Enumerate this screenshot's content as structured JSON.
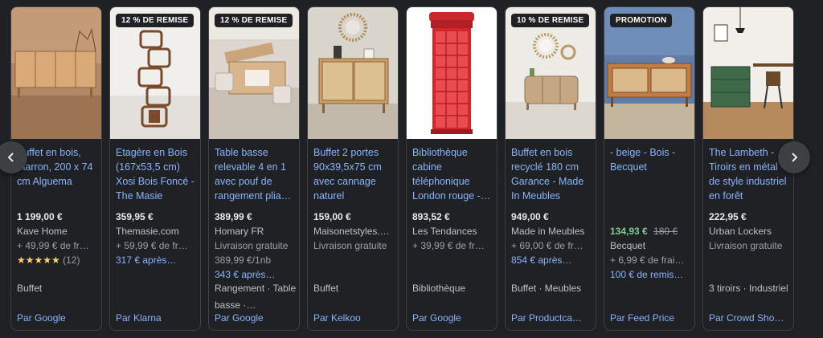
{
  "carousel": {
    "prev_icon": "chevron-left-icon",
    "next_icon": "chevron-right-icon",
    "products": [
      {
        "badge": "",
        "title": "Buffet en bois, marron, 200 x 74 cm Alguema",
        "price": "1 199,00 €",
        "merchant": "Kave Home",
        "shipping": "+ 49,99 € de fr…",
        "rating_stars": "★★★★★",
        "rating_count": "(12)",
        "category": "Buffet",
        "by": "Par Google"
      },
      {
        "badge": "12 % DE REMISE",
        "title": "Etagère en Bois (167x53,5 cm) Xosi Bois Foncé - The Masie",
        "price": "359,95 €",
        "merchant": "Themasie.com",
        "shipping": "+ 59,99 € de fr…",
        "payment": "317 € après…",
        "category": "",
        "by": "Par Klarna"
      },
      {
        "badge": "12 % DE REMISE",
        "title": "Table basse relevable 4 en 1 avec pouf de rangement plia…",
        "price": "389,99 €",
        "merchant": "Homary FR",
        "shipping": "Livraison gratuite",
        "unit_price": "389,99 €/1nb",
        "payment": "343 € après…",
        "category": "Rangement · Table basse ·…",
        "by": "Par Google"
      },
      {
        "badge": "",
        "title": "Buffet 2 portes 90x39,5x75 cm avec cannage naturel",
        "price": "159,00 €",
        "merchant": "Maisonetstyles.…",
        "shipping": "Livraison gratuite",
        "category": "Buffet",
        "by": "Par Kelkoo"
      },
      {
        "badge": "",
        "title": "Bibliothèque cabine téléphonique London rouge -…",
        "price": "893,52 €",
        "merchant": "Les Tendances",
        "shipping": "+ 39,99 € de fr…",
        "category": "Bibliothèque",
        "by": "Par Google"
      },
      {
        "badge": "10 % DE REMISE",
        "title": "Buffet en bois recyclé 180 cm Garance - Made In Meubles",
        "price": "949,00 €",
        "merchant": "Made in Meubles",
        "shipping": "+ 69,00 € de fr…",
        "payment": "854 € après…",
        "category": "Buffet · Meubles",
        "by": "Par Productca…"
      },
      {
        "badge": "PROMOTION",
        "title": "- beige - Bois - Becquet",
        "price": "134,93 €",
        "old_price": "180 €",
        "merchant": "Becquet",
        "shipping": "+ 6,99 € de frai…",
        "payment": "100 € de remis…",
        "category": "",
        "by": "Par Feed Price"
      },
      {
        "badge": "",
        "title": "The Lambeth - Tiroirs en métal de style industriel en forêt",
        "price": "222,95 €",
        "merchant": "Urban Lockers",
        "shipping": "Livraison gratuite",
        "category": "3 tiroirs · Industriel",
        "by": "Par Crowd Sho…"
      }
    ]
  },
  "colors": {
    "background": "#202124",
    "link": "#8ab4f8",
    "sale_price": "#81c995",
    "star": "#fdd663"
  }
}
